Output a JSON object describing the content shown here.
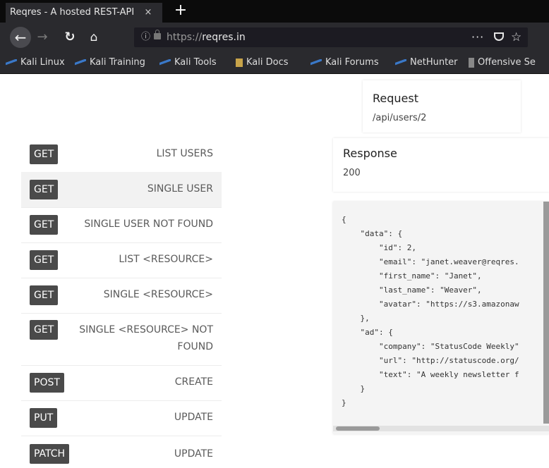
{
  "browser": {
    "tab_title": "Reqres - A hosted REST-API",
    "tab_close": "×",
    "new_tab": "+",
    "url_prefix": "https://",
    "url_host": "reqres.in",
    "page_actions": "···",
    "bookmarks": [
      {
        "label": "Kali Linux",
        "icon": "kali-dragon-icon"
      },
      {
        "label": "Kali Training",
        "icon": "kali-dragon-icon"
      },
      {
        "label": "Kali Tools",
        "icon": "kali-dragon-icon"
      },
      {
        "label": "Kali Docs",
        "icon": "doc-icon"
      },
      {
        "label": "Kali Forums",
        "icon": "kali-dragon-icon"
      },
      {
        "label": "NetHunter",
        "icon": "kali-dragon-icon"
      },
      {
        "label": "Offensive Se",
        "icon": "offsec-icon"
      }
    ]
  },
  "endpoints": [
    {
      "method": "GET",
      "label": "LIST USERS"
    },
    {
      "method": "GET",
      "label": "SINGLE USER",
      "active": true
    },
    {
      "method": "GET",
      "label": "SINGLE USER NOT FOUND"
    },
    {
      "method": "GET",
      "label": "LIST <RESOURCE>"
    },
    {
      "method": "GET",
      "label": "SINGLE <RESOURCE>"
    },
    {
      "method": "GET",
      "label_line1": "SINGLE <RESOURCE> NOT",
      "label_line2": "FOUND"
    },
    {
      "method": "POST",
      "label": "CREATE"
    },
    {
      "method": "PUT",
      "label": "UPDATE"
    },
    {
      "method": "PATCH",
      "label": "UPDATE"
    }
  ],
  "request": {
    "title": "Request",
    "value": "/api/users/2"
  },
  "response": {
    "title": "Response",
    "status": "200"
  },
  "response_body": "{\n    \"data\": {\n        \"id\": 2,\n        \"email\": \"janet.weaver@reqres.\n        \"first_name\": \"Janet\",\n        \"last_name\": \"Weaver\",\n        \"avatar\": \"https://s3.amazonaw\n    },\n    \"ad\": {\n        \"company\": \"StatusCode Weekly\"\n        \"url\": \"http://statuscode.org/\n        \"text\": \"A weekly newsletter f\n    }\n}"
}
